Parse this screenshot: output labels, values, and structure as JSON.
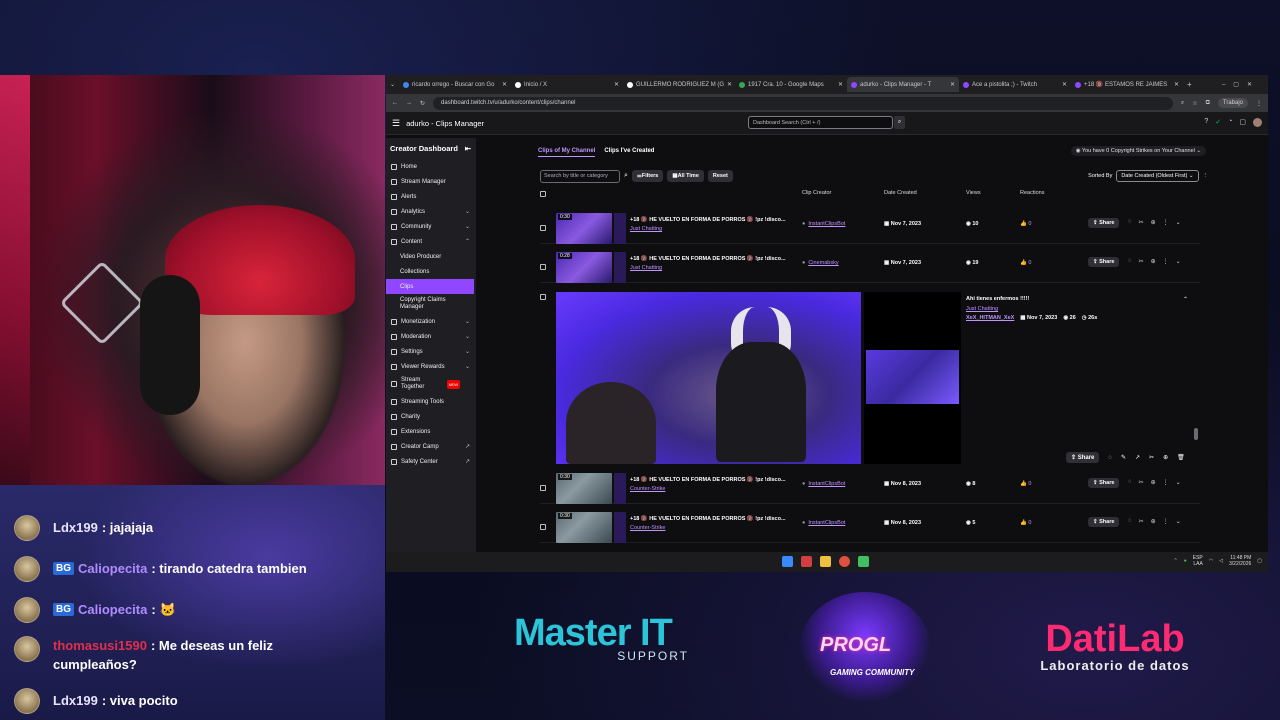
{
  "browser": {
    "tabs": [
      {
        "label": "ricardo orrego - Buscar con Go"
      },
      {
        "label": "Inicio / X"
      },
      {
        "label": "GUILLERMO RODRIGUEZ M (G"
      },
      {
        "label": "1917 Cra. 10 - Google Maps"
      },
      {
        "label": "adurko - Clips Manager - T"
      },
      {
        "label": "Ace a pistolita ;) - Twitch"
      },
      {
        "label": "+18 🔞 ESTAMOS RE JAIMES"
      }
    ],
    "url": "dashboard.twitch.tv/u/adurko/content/clips/channel",
    "profile": "Trabajo"
  },
  "twitch": {
    "window_title": "adurko - Clips Manager",
    "search_placeholder": "Dashboard Search (Ctrl + /)",
    "sidebar_title": "Creator Dashboard",
    "sidebar": [
      {
        "label": "Home"
      },
      {
        "label": "Stream Manager"
      },
      {
        "label": "Alerts"
      },
      {
        "label": "Analytics"
      },
      {
        "label": "Community"
      },
      {
        "label": "Content"
      },
      {
        "label": "Video Producer"
      },
      {
        "label": "Collections"
      },
      {
        "label": "Clips"
      },
      {
        "label": "Copyright Claims Manager"
      },
      {
        "label": "Monetization"
      },
      {
        "label": "Moderation"
      },
      {
        "label": "Settings"
      },
      {
        "label": "Viewer Rewards"
      },
      {
        "label": "Stream Together"
      },
      {
        "label": "Streaming Tools"
      },
      {
        "label": "Charity"
      },
      {
        "label": "Extensions"
      },
      {
        "label": "Creator Camp"
      },
      {
        "label": "Safety Center"
      }
    ],
    "new_badge": "NEW",
    "subtabs": [
      "Clips of My Channel",
      "Clips I've Created"
    ],
    "strikes": "You have 0 Copyright Strikes on Your Channel",
    "filter": {
      "search_placeholder": "Search by title or category",
      "filters": "Filters",
      "all_time": "All Time",
      "reset": "Reset",
      "sorted_by": "Sorted By",
      "sort_value": "Date Created (Oldest First)"
    },
    "columns": {
      "creator": "Clip Creator",
      "date": "Date Created",
      "views": "Views",
      "reactions": "Reactions"
    },
    "rows": [
      {
        "duration": "0:30",
        "title": "+18 🔞 HE VUELTO EN FORMA DE PORROS 🔞 !pz !disco...",
        "category": "Just Chatting",
        "creator": "InstantClipsBot",
        "date": "Nov 7, 2023",
        "views": "10",
        "reactions": "0",
        "share": "Share"
      },
      {
        "duration": "0:28",
        "title": "+18 🔞 HE VUELTO EN FORMA DE PORROS 🔞 !pz !disco...",
        "category": "Just Chatting",
        "creator": "Cinemabsky",
        "date": "Nov 7, 2023",
        "views": "19",
        "reactions": "0",
        "share": "Share"
      },
      {
        "duration": "0:30",
        "title": "+18 🔞 HE VUELTO EN FORMA DE PORROS 🔞 !pz !disco...",
        "category": "Counter-Strike",
        "creator": "InstantClipsBot",
        "date": "Nov 8, 2023",
        "views": "8",
        "reactions": "0",
        "share": "Share"
      },
      {
        "duration": "0:30",
        "title": "+18 🔞 HE VUELTO EN FORMA DE PORROS 🔞 !pz !disco...",
        "category": "Counter-Strike",
        "creator": "InstantClipsBot",
        "date": "Nov 8, 2023",
        "views": "5",
        "reactions": "0",
        "share": "Share"
      }
    ],
    "expanded": {
      "title": "Ahi tienes enfermos !!!!!",
      "category": "Just Chatting",
      "creator": "XeX_HITMAN_XeX",
      "date": "Nov 7, 2023",
      "views": "26",
      "length": "26s",
      "share": "Share"
    }
  },
  "taskbar": {
    "lang": "ESP",
    "region": "LAA",
    "time": "11:48 PM",
    "date": "3/22/2026"
  },
  "chat": [
    {
      "user": "Ldx199",
      "text": ": jajajaja",
      "badge": ""
    },
    {
      "user": "Caliopecita",
      "text": ": tirando catedra tambien",
      "badge": "BG"
    },
    {
      "user": "Caliopecita",
      "text": ":",
      "badge": "BG"
    },
    {
      "user": "thomasusi1590",
      "text": ": Me deseas un feliz cumpleaños?",
      "badge": ""
    },
    {
      "user": "Ldx199",
      "text": ": viva pocito",
      "badge": ""
    }
  ],
  "sponsors": {
    "master_title": "Master IT",
    "master_sub": "SUPPORT",
    "progl_title": "PROGL",
    "progl_sub": "GAMING COMMUNITY",
    "datilab_title": "DatiLab",
    "datilab_sub": "Laboratorio de datos"
  }
}
